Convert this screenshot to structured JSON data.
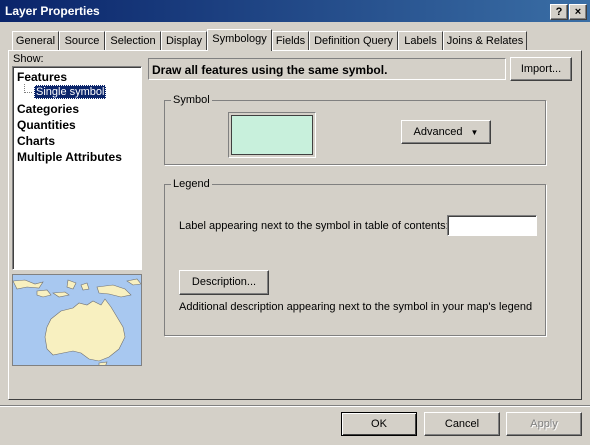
{
  "window": {
    "title": "Layer Properties",
    "help_label": "?",
    "close_label": "×"
  },
  "tabs": [
    {
      "label": "General"
    },
    {
      "label": "Source"
    },
    {
      "label": "Selection"
    },
    {
      "label": "Display"
    },
    {
      "label": "Symbology",
      "active": true
    },
    {
      "label": "Fields"
    },
    {
      "label": "Definition Query"
    },
    {
      "label": "Labels"
    },
    {
      "label": "Joins & Relates"
    }
  ],
  "show": {
    "label": "Show:",
    "items": [
      {
        "label": "Features"
      },
      {
        "label": "Single symbol",
        "selected": true
      },
      {
        "label": "Categories"
      },
      {
        "label": "Quantities"
      },
      {
        "label": "Charts"
      },
      {
        "label": "Multiple Attributes"
      }
    ]
  },
  "header": {
    "text": "Draw all features using the same symbol.",
    "import_label": "Import..."
  },
  "symbol": {
    "group_label": "Symbol",
    "fill_color": "#c8f0dc",
    "advanced_label": "Advanced"
  },
  "legend": {
    "group_label": "Legend",
    "label_prompt": "Label appearing next to the symbol in table of contents:",
    "label_value": "",
    "description_label": "Description...",
    "description_hint": "Additional description appearing next to the symbol in your map's legend"
  },
  "buttons": {
    "ok": "OK",
    "cancel": "Cancel",
    "apply": "Apply"
  },
  "colors": {
    "title_start": "#0a246a",
    "title_end": "#3a6ea5",
    "face": "#d4d0c8",
    "selection": "#0a246a",
    "sea": "#a8c8f0",
    "land": "#f8f0c0"
  }
}
